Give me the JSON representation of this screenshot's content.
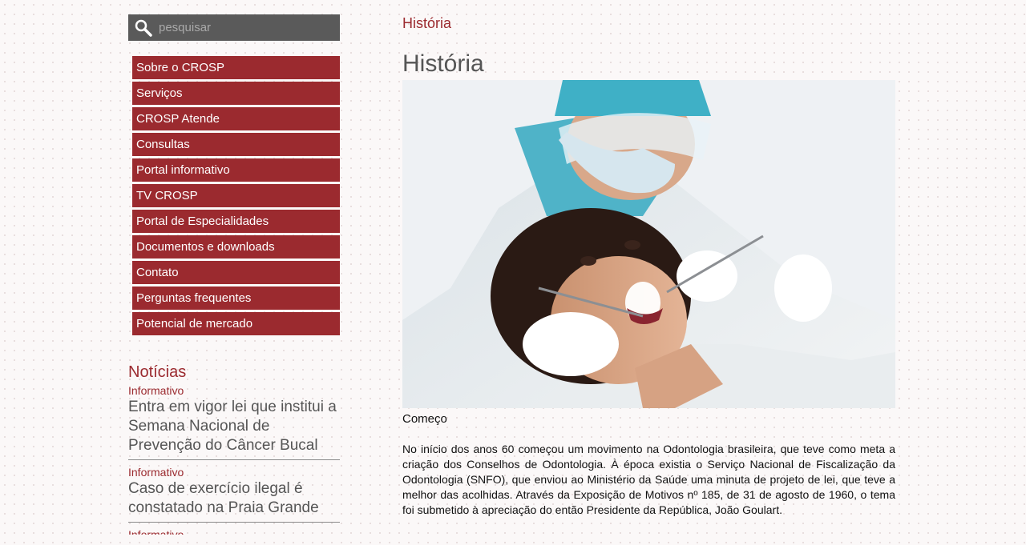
{
  "search": {
    "placeholder": "pesquisar"
  },
  "nav": {
    "items": [
      "Sobre o CROSP",
      "Serviços",
      "CROSP Atende",
      "Consultas",
      "Portal informativo",
      "TV CROSP",
      "Portal de Especialidades",
      "Documentos e downloads",
      "Contato",
      "Perguntas frequentes",
      "Potencial de mercado"
    ]
  },
  "news": {
    "title": "Notícias",
    "items": [
      {
        "category": "Informativo",
        "headline": "Entra em vigor lei que institui a Semana Nacional de Prevenção do Câncer Bucal"
      },
      {
        "category": "Informativo",
        "headline": "Caso de exercício ilegal é constatado na Praia Grande"
      },
      {
        "category": "Informativo",
        "headline": ""
      }
    ]
  },
  "main": {
    "breadcrumb": "História",
    "title": "História",
    "caption": "Começo",
    "body": "No início dos anos 60 começou um movimento na Odontologia brasileira, que teve como meta a criação dos Conselhos de Odontologia. À época existia o Serviço Nacional de Fiscalização da Odontologia (SNFO), que enviou ao Ministério da Saúde uma minuta de projeto de lei, que teve a melhor das acolhidas. Através da Exposição de Motivos nº 185, de 31 de agosto de 1960, o tema foi submetido à apreciação do então Presidente da República, João Goulart."
  },
  "colors": {
    "accent": "#9b2a2f",
    "search_bg": "#5a5a5a",
    "heading": "#555555"
  },
  "icons": {
    "search": "search-icon"
  }
}
